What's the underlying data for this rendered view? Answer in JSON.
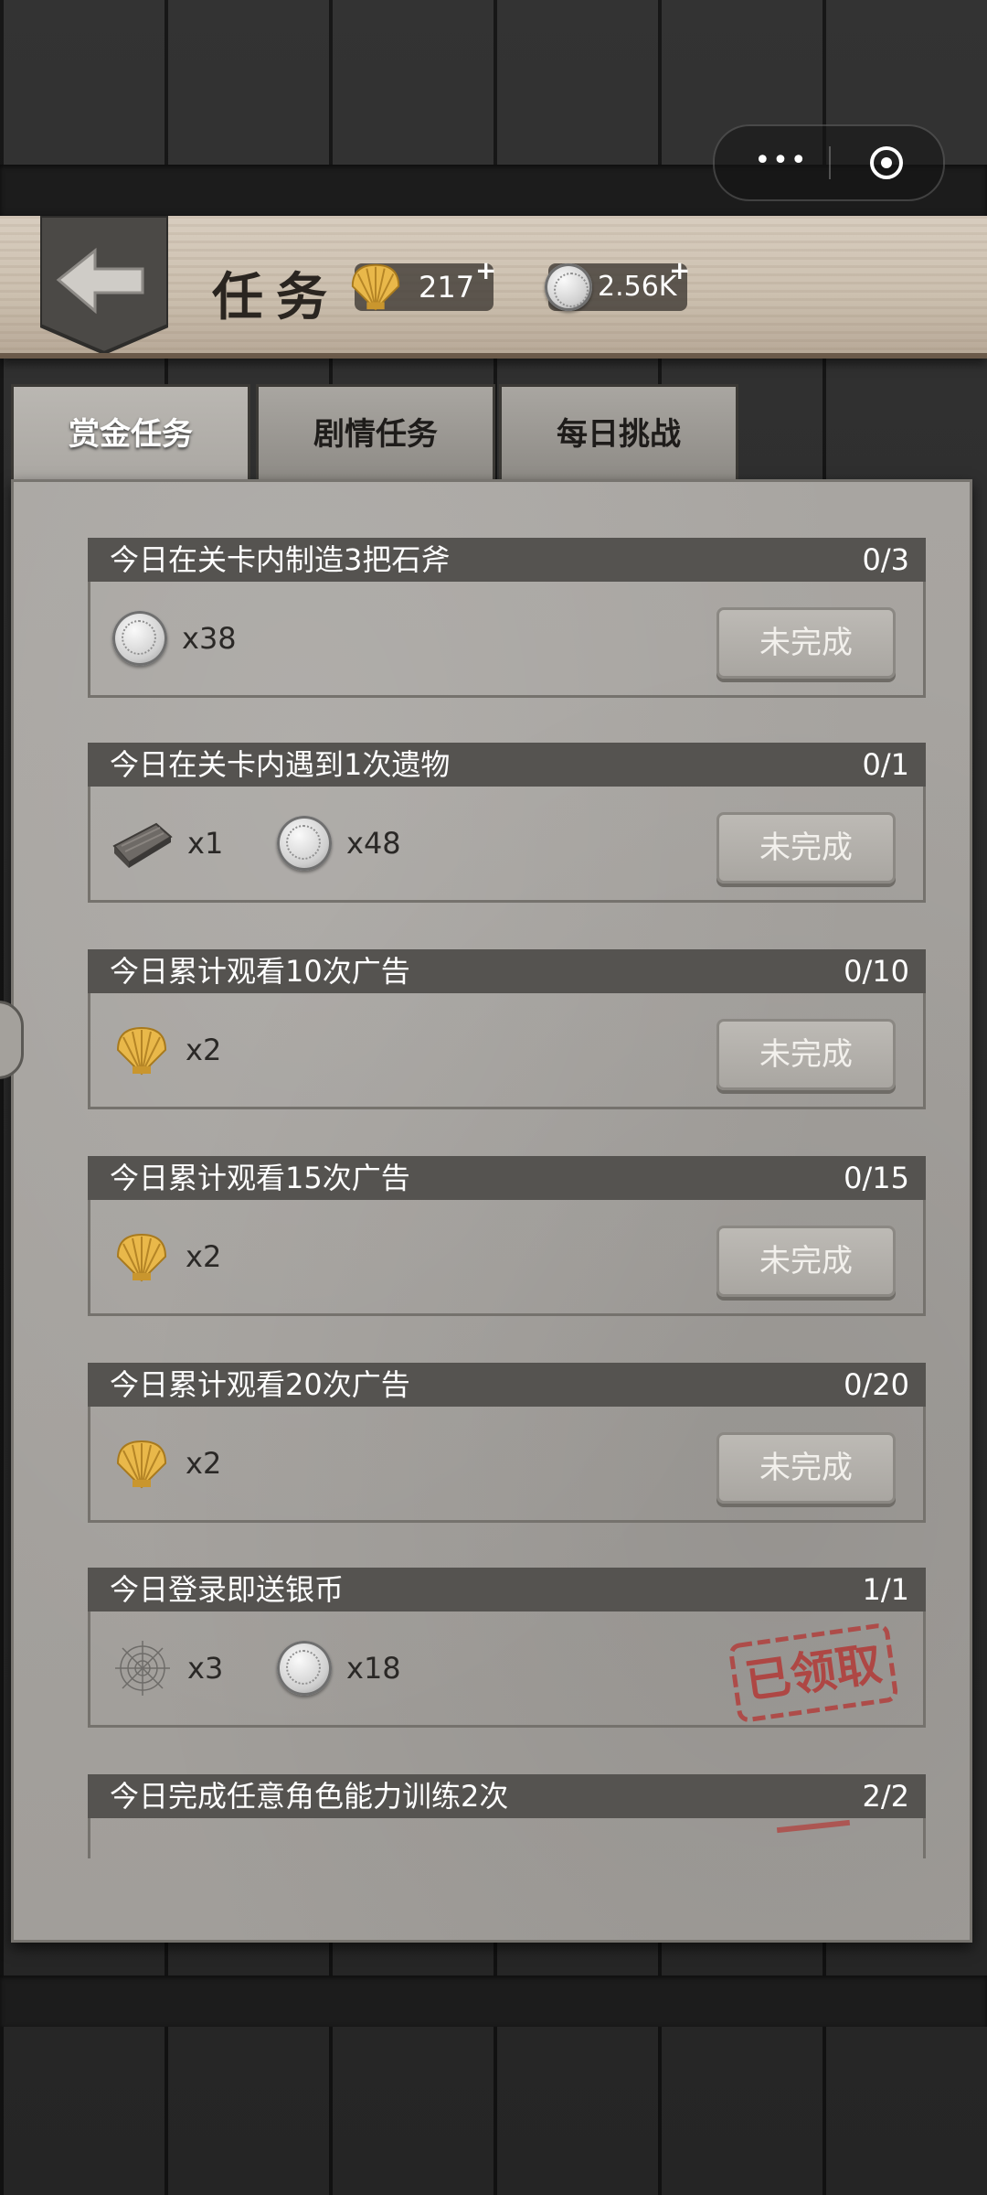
{
  "header": {
    "title": "任务",
    "shells": "217",
    "coins": "2.56K",
    "plus": "+"
  },
  "capsule": {
    "menu": "•••"
  },
  "tabs": [
    {
      "label": "赏金任务",
      "active": true
    },
    {
      "label": "剧情任务",
      "active": false
    },
    {
      "label": "每日挑战",
      "active": false
    }
  ],
  "tasks": [
    {
      "title": "今日在关卡内制造3把石斧",
      "progress": "0/3",
      "rewards": [
        {
          "icon": "silver-coin-icon",
          "qty": "x38"
        }
      ],
      "status": "未完成"
    },
    {
      "title": "今日在关卡内遇到1次遗物",
      "progress": "0/1",
      "rewards": [
        {
          "icon": "wood-plank-icon",
          "qty": "x1"
        },
        {
          "icon": "silver-coin-icon",
          "qty": "x48"
        }
      ],
      "status": "未完成"
    },
    {
      "title": "今日累计观看10次广告",
      "progress": "0/10",
      "rewards": [
        {
          "icon": "gold-shell-icon",
          "qty": "x2"
        }
      ],
      "status": "未完成"
    },
    {
      "title": "今日累计观看15次广告",
      "progress": "0/15",
      "rewards": [
        {
          "icon": "gold-shell-icon",
          "qty": "x2"
        }
      ],
      "status": "未完成"
    },
    {
      "title": "今日累计观看20次广告",
      "progress": "0/20",
      "rewards": [
        {
          "icon": "gold-shell-icon",
          "qty": "x2"
        }
      ],
      "status": "未完成"
    },
    {
      "title": "今日登录即送银币",
      "progress": "1/1",
      "rewards": [
        {
          "icon": "spider-web-icon",
          "qty": "x3"
        },
        {
          "icon": "silver-coin-icon",
          "qty": "x18"
        }
      ],
      "status": "已领取"
    },
    {
      "title": "今日完成任意角色能力训练2次",
      "progress": "2/2",
      "rewards": [],
      "status": ""
    }
  ]
}
